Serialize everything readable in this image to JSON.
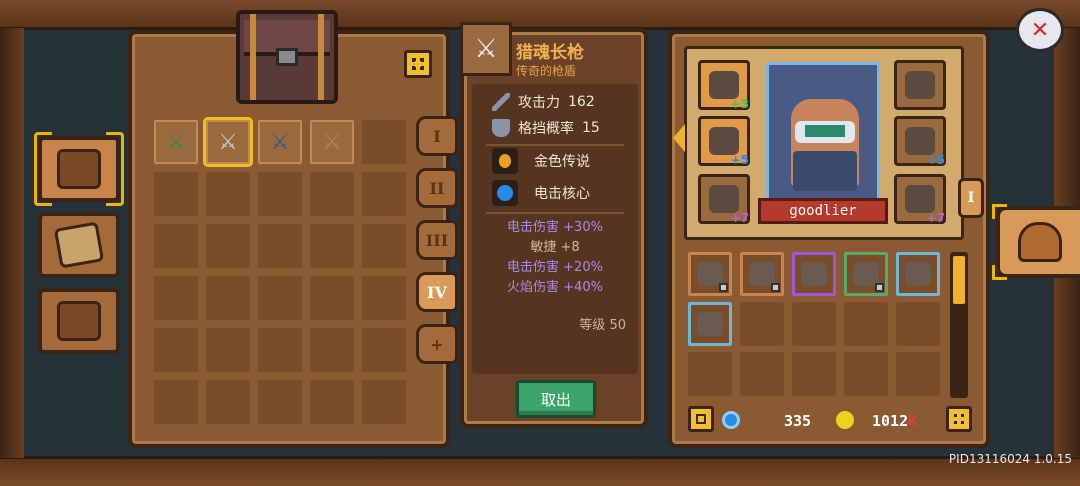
{
  "side_tabs": [
    {
      "name": "storage-chest",
      "active": true
    },
    {
      "name": "handbook",
      "active": false
    },
    {
      "name": "exchange",
      "active": false
    }
  ],
  "storage": {
    "items": [
      {
        "icon": "feather-blade-icon",
        "color": "#2f8a4a"
      },
      {
        "icon": "spear-icon",
        "color": "#c8c8d8",
        "selected": true
      },
      {
        "icon": "axe-icon",
        "color": "#2f5a8a"
      },
      {
        "icon": "cleaver-icon",
        "color": "#c07a5a"
      }
    ],
    "page_tabs": [
      "I",
      "II",
      "III",
      "IV",
      "+"
    ],
    "active_page": "IV"
  },
  "detail": {
    "name": "猎魂长枪",
    "subtitle": "传奇的枪盾",
    "stats": [
      {
        "icon": "sword-icon",
        "label": "攻击力",
        "value": "162"
      },
      {
        "icon": "shield-icon",
        "label": "格挡概率",
        "value": "15"
      }
    ],
    "effects": [
      {
        "icon": "fire-orb-icon",
        "label": "金色传说",
        "color": "#f0a020"
      },
      {
        "icon": "lightning-orb-icon",
        "label": "电击核心",
        "color": "#2a8ae8"
      }
    ],
    "bonuses": [
      {
        "text": "电击伤害 +30%",
        "color": "#a88ae8"
      },
      {
        "text": "敏捷 +8",
        "color": "#d8b89a"
      },
      {
        "text": "电击伤害 +20%",
        "color": "#a88ae8"
      },
      {
        "text": "火焰伤害 +40%",
        "color": "#a88ae8"
      }
    ],
    "level_label": "等级",
    "level_value": "50",
    "take_out_label": "取出"
  },
  "equipment": {
    "slots": [
      {
        "icon": "ring-icon",
        "plus": "+3",
        "plus_color": "#2ad05a",
        "gold": true
      },
      {
        "icon": "bracer-icon",
        "plus": "+5",
        "plus_color": "#2a8ae8",
        "gold": true
      },
      {
        "icon": "boots-icon",
        "plus": "+7",
        "plus_color": "#b060e8",
        "gold": false
      },
      {
        "icon": "gauntlet-icon",
        "plus": "",
        "plus_color": "#fff",
        "gold": false
      },
      {
        "icon": "chest-armor-icon",
        "plus": "+5",
        "plus_color": "#2a8ae8",
        "gold": false
      },
      {
        "icon": "spear-icon",
        "plus": "+7",
        "plus_color": "#b060e8",
        "gold": false
      }
    ],
    "character_name": "goodlier",
    "set_indicator": "I"
  },
  "bag": {
    "items": [
      {
        "icon": "cleaver-icon",
        "border": "#c8844a",
        "locked": true
      },
      {
        "icon": "boots-icon",
        "border": "#c8844a",
        "locked": true
      },
      {
        "icon": "bow-icon",
        "border": "#9a5ad8",
        "locked": false
      },
      {
        "icon": "helmet-icon",
        "border": "#5aa86a",
        "locked": true
      },
      {
        "icon": "feather-icon",
        "border": "#6ab8d8",
        "locked": false
      },
      {
        "icon": "feather-icon",
        "border": "#6ab8d8",
        "locked": false
      }
    ]
  },
  "currency": {
    "gems": "335",
    "gold": "1012",
    "gold_suffix": "K"
  },
  "version_text": "PID13116024 1.0.15",
  "colors": {
    "accent_gold": "#f0b030",
    "take_out_green": "#3aa46a",
    "name_plate_red": "#b43a2e"
  }
}
